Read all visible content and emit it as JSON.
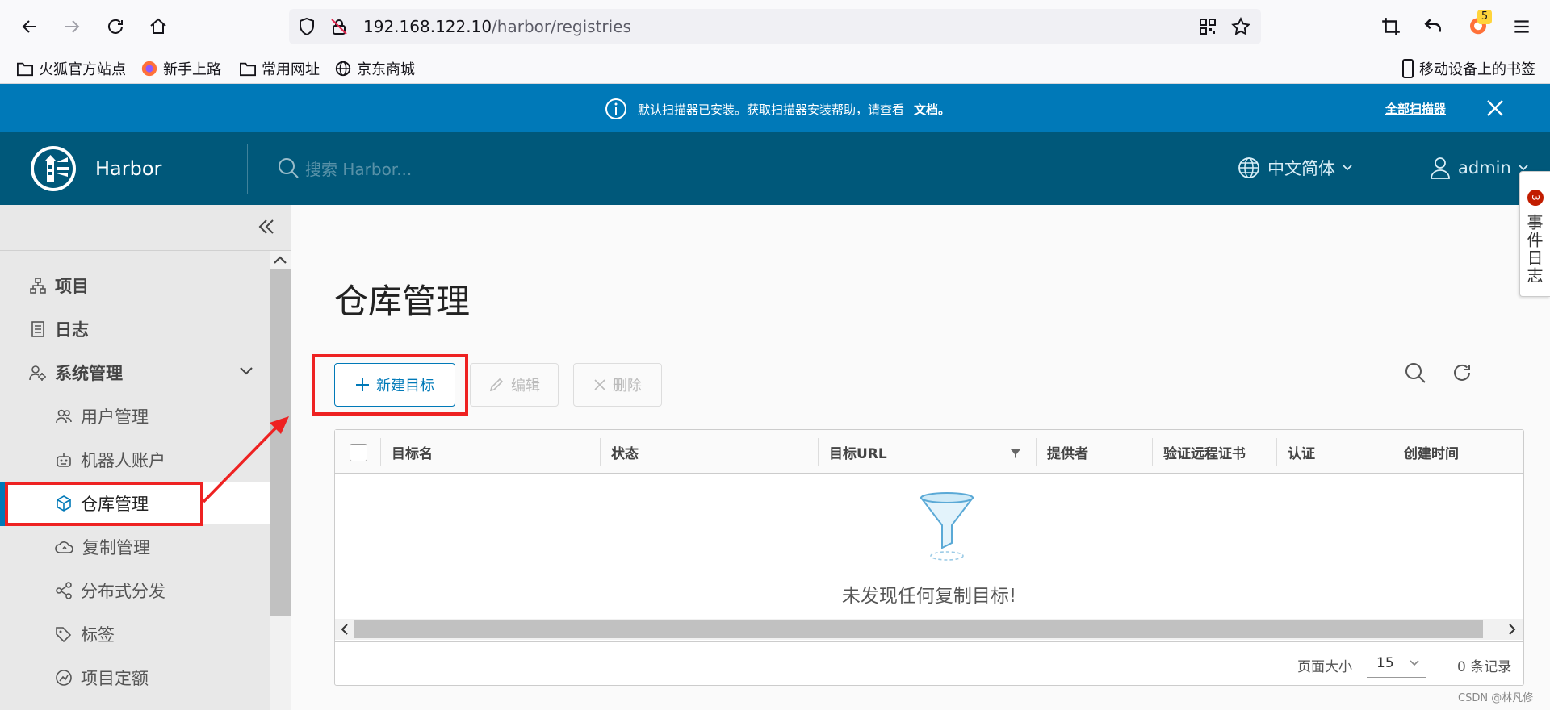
{
  "browser": {
    "url_host": "192.168.122.10",
    "url_path": "/harbor/registries",
    "bookmarks": [
      {
        "label": "火狐官方站点",
        "icon": "folder-icon"
      },
      {
        "label": "新手上路",
        "icon": "firefox-icon"
      },
      {
        "label": "常用网址",
        "icon": "folder-icon"
      },
      {
        "label": "京东商城",
        "icon": "globe-icon"
      }
    ],
    "mobile_bookmarks": "移动设备上的书签",
    "extension_badge": "5"
  },
  "banner": {
    "message": "默认扫描器已安装。获取扫描器安装帮助，请查看",
    "doc_link": "文档。",
    "all_scanners": "全部扫描器"
  },
  "header": {
    "brand": "Harbor",
    "search_placeholder": "搜索 Harbor...",
    "language": "中文简体",
    "user": "admin"
  },
  "event_log": {
    "label": "事件日志",
    "count": "3"
  },
  "sidebar": {
    "items": [
      {
        "label": "项目",
        "icon": "projects-icon",
        "level": "top"
      },
      {
        "label": "日志",
        "icon": "logs-icon",
        "level": "top"
      },
      {
        "label": "系统管理",
        "icon": "admin-icon",
        "level": "top",
        "expanded": true
      },
      {
        "label": "用户管理",
        "icon": "users-icon",
        "level": "sub"
      },
      {
        "label": "机器人账户",
        "icon": "robot-icon",
        "level": "sub"
      },
      {
        "label": "仓库管理",
        "icon": "cube-icon",
        "level": "sub",
        "active": true
      },
      {
        "label": "复制管理",
        "icon": "cloud-icon",
        "level": "sub"
      },
      {
        "label": "分布式分发",
        "icon": "share-icon",
        "level": "sub"
      },
      {
        "label": "标签",
        "icon": "tag-icon",
        "level": "sub"
      },
      {
        "label": "项目定额",
        "icon": "quota-icon",
        "level": "sub"
      }
    ]
  },
  "main": {
    "title": "仓库管理",
    "actions": {
      "new": "新建目标",
      "edit": "编辑",
      "delete": "删除"
    },
    "table": {
      "columns": [
        "目标名",
        "状态",
        "目标URL",
        "提供者",
        "验证远程证书",
        "认证",
        "创建时间"
      ],
      "empty_message": "未发现任何复制目标!"
    },
    "pagination": {
      "page_size_label": "页面大小",
      "page_size": "15",
      "count": "0 条记录"
    }
  },
  "colors": {
    "banner": "#0079b8",
    "header": "#00587a",
    "accent": "#0079b8",
    "annotation": "#ee2222"
  },
  "watermark": "CSDN @林凡修"
}
